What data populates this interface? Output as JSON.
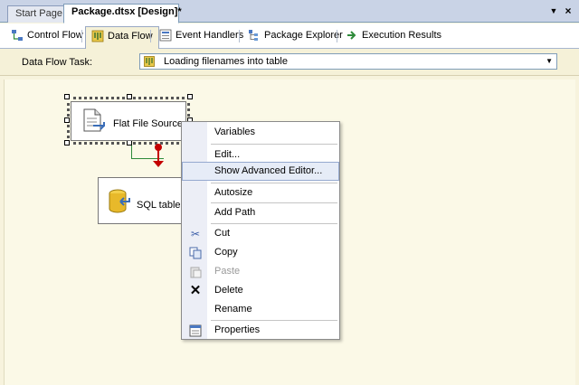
{
  "doc_tabs": {
    "start_label": "Start Page",
    "package_label": "Package.dtsx [Design]*"
  },
  "designer_tabs": [
    {
      "label": "Control Flow",
      "icon": "control-flow-icon"
    },
    {
      "label": "Data Flow",
      "icon": "data-flow-icon"
    },
    {
      "label": "Event Handlers",
      "icon": "event-handlers-icon"
    },
    {
      "label": "Package Explorer",
      "icon": "package-explorer-icon"
    },
    {
      "label": "Execution Results",
      "icon": "execution-results-icon"
    }
  ],
  "task": {
    "label": "Data Flow Task:",
    "value": "Loading filenames into table"
  },
  "components": {
    "flat_file": "Flat File Source",
    "sql_dest": "SQL table w"
  },
  "context_menu": {
    "items": [
      {
        "label": "Variables"
      },
      {
        "label": "Edit..."
      },
      {
        "label": "Show Advanced Editor..."
      },
      {
        "label": "Autosize"
      },
      {
        "label": "Add Path"
      },
      {
        "label": "Cut",
        "icon": "scissors-icon"
      },
      {
        "label": "Copy",
        "icon": "copy-icon"
      },
      {
        "label": "Paste",
        "icon": "paste-icon",
        "disabled": true
      },
      {
        "label": "Delete",
        "icon": "delete-icon"
      },
      {
        "label": "Rename"
      },
      {
        "label": "Properties",
        "icon": "properties-icon"
      }
    ]
  },
  "colors": {
    "tab_bar": "#c9d3e6",
    "canvas": "#fbf9e7",
    "success_path": "#2e8b3a",
    "error_path": "#c40000",
    "highlight": "#e6ecf7"
  }
}
